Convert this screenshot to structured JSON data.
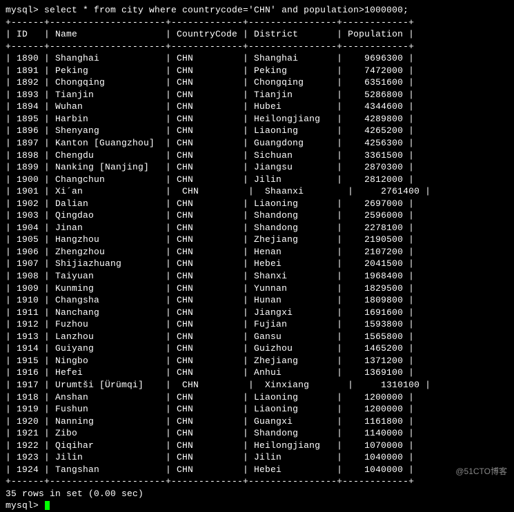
{
  "prompt1": "mysql> ",
  "query": "select * from city where countrycode='CHN' and population>1000000;",
  "columns": [
    "ID",
    "Name",
    "CountryCode",
    "District",
    "Population"
  ],
  "widths": {
    "id": 4,
    "name": 19,
    "code": 11,
    "district": 14,
    "pop": 10
  },
  "extra_rows": [
    11,
    27
  ],
  "rows": [
    {
      "id": 1890,
      "name": "Shanghai",
      "code": "CHN",
      "district": "Shanghai",
      "pop": 9696300
    },
    {
      "id": 1891,
      "name": "Peking",
      "code": "CHN",
      "district": "Peking",
      "pop": 7472000
    },
    {
      "id": 1892,
      "name": "Chongqing",
      "code": "CHN",
      "district": "Chongqing",
      "pop": 6351600
    },
    {
      "id": 1893,
      "name": "Tianjin",
      "code": "CHN",
      "district": "Tianjin",
      "pop": 5286800
    },
    {
      "id": 1894,
      "name": "Wuhan",
      "code": "CHN",
      "district": "Hubei",
      "pop": 4344600
    },
    {
      "id": 1895,
      "name": "Harbin",
      "code": "CHN",
      "district": "Heilongjiang",
      "pop": 4289800
    },
    {
      "id": 1896,
      "name": "Shenyang",
      "code": "CHN",
      "district": "Liaoning",
      "pop": 4265200
    },
    {
      "id": 1897,
      "name": "Kanton [Guangzhou]",
      "code": "CHN",
      "district": "Guangdong",
      "pop": 4256300
    },
    {
      "id": 1898,
      "name": "Chengdu",
      "code": "CHN",
      "district": "Sichuan",
      "pop": 3361500
    },
    {
      "id": 1899,
      "name": "Nanking [Nanjing]",
      "code": "CHN",
      "district": "Jiangsu",
      "pop": 2870300
    },
    {
      "id": 1900,
      "name": "Changchun",
      "code": "CHN",
      "district": "Jilin",
      "pop": 2812000
    },
    {
      "id": 1901,
      "name": "Xi´an",
      "code": " CHN",
      "district": " Shaanxi",
      "pop": 2761400
    },
    {
      "id": 1902,
      "name": "Dalian",
      "code": "CHN",
      "district": "Liaoning",
      "pop": 2697000
    },
    {
      "id": 1903,
      "name": "Qingdao",
      "code": "CHN",
      "district": "Shandong",
      "pop": 2596000
    },
    {
      "id": 1904,
      "name": "Jinan",
      "code": "CHN",
      "district": "Shandong",
      "pop": 2278100
    },
    {
      "id": 1905,
      "name": "Hangzhou",
      "code": "CHN",
      "district": "Zhejiang",
      "pop": 2190500
    },
    {
      "id": 1906,
      "name": "Zhengzhou",
      "code": "CHN",
      "district": "Henan",
      "pop": 2107200
    },
    {
      "id": 1907,
      "name": "Shijiazhuang",
      "code": "CHN",
      "district": "Hebei",
      "pop": 2041500
    },
    {
      "id": 1908,
      "name": "Taiyuan",
      "code": "CHN",
      "district": "Shanxi",
      "pop": 1968400
    },
    {
      "id": 1909,
      "name": "Kunming",
      "code": "CHN",
      "district": "Yunnan",
      "pop": 1829500
    },
    {
      "id": 1910,
      "name": "Changsha",
      "code": "CHN",
      "district": "Hunan",
      "pop": 1809800
    },
    {
      "id": 1911,
      "name": "Nanchang",
      "code": "CHN",
      "district": "Jiangxi",
      "pop": 1691600
    },
    {
      "id": 1912,
      "name": "Fuzhou",
      "code": "CHN",
      "district": "Fujian",
      "pop": 1593800
    },
    {
      "id": 1913,
      "name": "Lanzhou",
      "code": "CHN",
      "district": "Gansu",
      "pop": 1565800
    },
    {
      "id": 1914,
      "name": "Guiyang",
      "code": "CHN",
      "district": "Guizhou",
      "pop": 1465200
    },
    {
      "id": 1915,
      "name": "Ningbo",
      "code": "CHN",
      "district": "Zhejiang",
      "pop": 1371200
    },
    {
      "id": 1916,
      "name": "Hefei",
      "code": "CHN",
      "district": "Anhui",
      "pop": 1369100
    },
    {
      "id": 1917,
      "name": "Urumtši [Ürümqi]",
      "code": " CHN",
      "district": " Xinxiang",
      "pop": 1310100
    },
    {
      "id": 1918,
      "name": "Anshan",
      "code": "CHN",
      "district": "Liaoning",
      "pop": 1200000
    },
    {
      "id": 1919,
      "name": "Fushun",
      "code": "CHN",
      "district": "Liaoning",
      "pop": 1200000
    },
    {
      "id": 1920,
      "name": "Nanning",
      "code": "CHN",
      "district": "Guangxi",
      "pop": 1161800
    },
    {
      "id": 1921,
      "name": "Zibo",
      "code": "CHN",
      "district": "Shandong",
      "pop": 1140000
    },
    {
      "id": 1922,
      "name": "Qiqihar",
      "code": "CHN",
      "district": "Heilongjiang",
      "pop": 1070000
    },
    {
      "id": 1923,
      "name": "Jilin",
      "code": "CHN",
      "district": "Jilin",
      "pop": 1040000
    },
    {
      "id": 1924,
      "name": "Tangshan",
      "code": "CHN",
      "district": "Hebei",
      "pop": 1040000
    }
  ],
  "footer": "35 rows in set (0.00 sec)",
  "prompt2": "mysql> ",
  "watermark": "@51CTO博客"
}
